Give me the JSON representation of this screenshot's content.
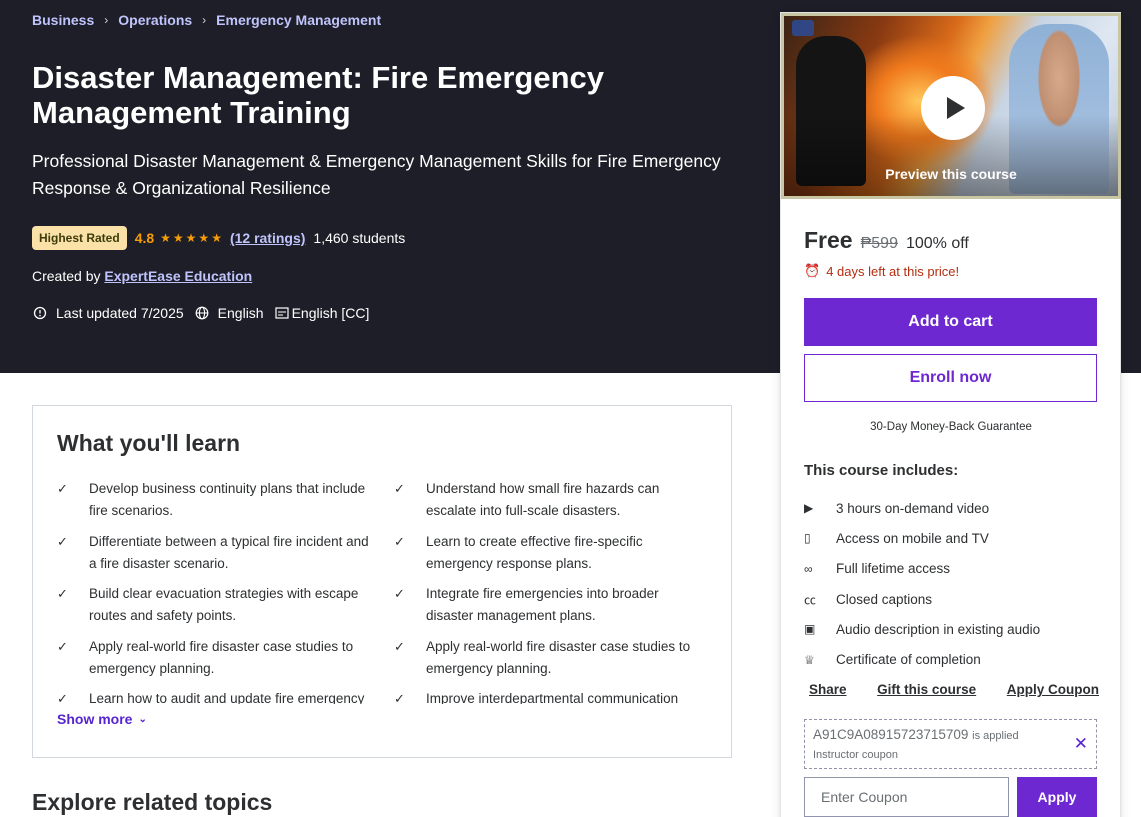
{
  "breadcrumb": [
    "Business",
    "Operations",
    "Emergency Management"
  ],
  "course": {
    "title": "Disaster Management: Fire Emergency Management Training",
    "subtitle": "Professional Disaster Management & Emergency Management Skills for Fire Emergency Response & Organizational Resilience",
    "badge": "Highest Rated",
    "rating": "4.8",
    "stars": "★★★★★",
    "ratings_count": "(12 ratings)",
    "students": "1,460 students",
    "created_by_label": "Created by",
    "instructor": "ExpertEase Education",
    "last_updated": "Last updated 7/2025",
    "language": "English",
    "captions": "English [CC]"
  },
  "learn": {
    "heading": "What you'll learn",
    "items": [
      "Develop business continuity plans that include fire scenarios.",
      "Understand how small fire hazards can escalate into full-scale disasters.",
      "Differentiate between a typical fire incident and a fire disaster scenario.",
      "Learn to create effective fire-specific emergency response plans.",
      "Build clear evacuation strategies with escape routes and safety points.",
      "Integrate fire emergencies into broader disaster management plans.",
      "Apply real-world fire disaster case studies to emergency planning.",
      "Apply real-world fire disaster case studies to emergency planning.",
      "Learn how to audit and update fire emergency",
      "Improve interdepartmental communication"
    ],
    "show_more": "Show more"
  },
  "explore_heading": "Explore related topics",
  "sidebar": {
    "preview_label": "Preview this course",
    "price": "Free",
    "old_price": "₱599",
    "discount": "100% off",
    "countdown": "4 days left at this price!",
    "add_to_cart": "Add to cart",
    "enroll_now": "Enroll now",
    "guarantee": "30-Day Money-Back Guarantee",
    "includes_title": "This course includes:",
    "includes": [
      {
        "icon": "video-icon",
        "glyph": "▶",
        "label": "3 hours on-demand video"
      },
      {
        "icon": "mobile-icon",
        "glyph": "▯",
        "label": "Access on mobile and TV"
      },
      {
        "icon": "infinity-icon",
        "glyph": "∞",
        "label": "Full lifetime access"
      },
      {
        "icon": "cc-icon",
        "glyph": "㏄",
        "label": "Closed captions"
      },
      {
        "icon": "audio-description-icon",
        "glyph": "▣",
        "label": "Audio description in existing audio"
      },
      {
        "icon": "trophy-icon",
        "glyph": "♕",
        "label": "Certificate of completion"
      }
    ],
    "share": "Share",
    "gift": "Gift this course",
    "apply_coupon": "Apply Coupon",
    "coupon_code": "A91C9A08915723715709",
    "coupon_applied": "is applied",
    "coupon_type": "Instructor coupon",
    "coupon_placeholder": "Enter Coupon",
    "apply": "Apply"
  },
  "colors": {
    "hero_bg": "#1d1e27",
    "accent": "#6d28d2",
    "link": "#c0c4fc",
    "star": "#f69c08",
    "alert": "#b32d0f"
  }
}
